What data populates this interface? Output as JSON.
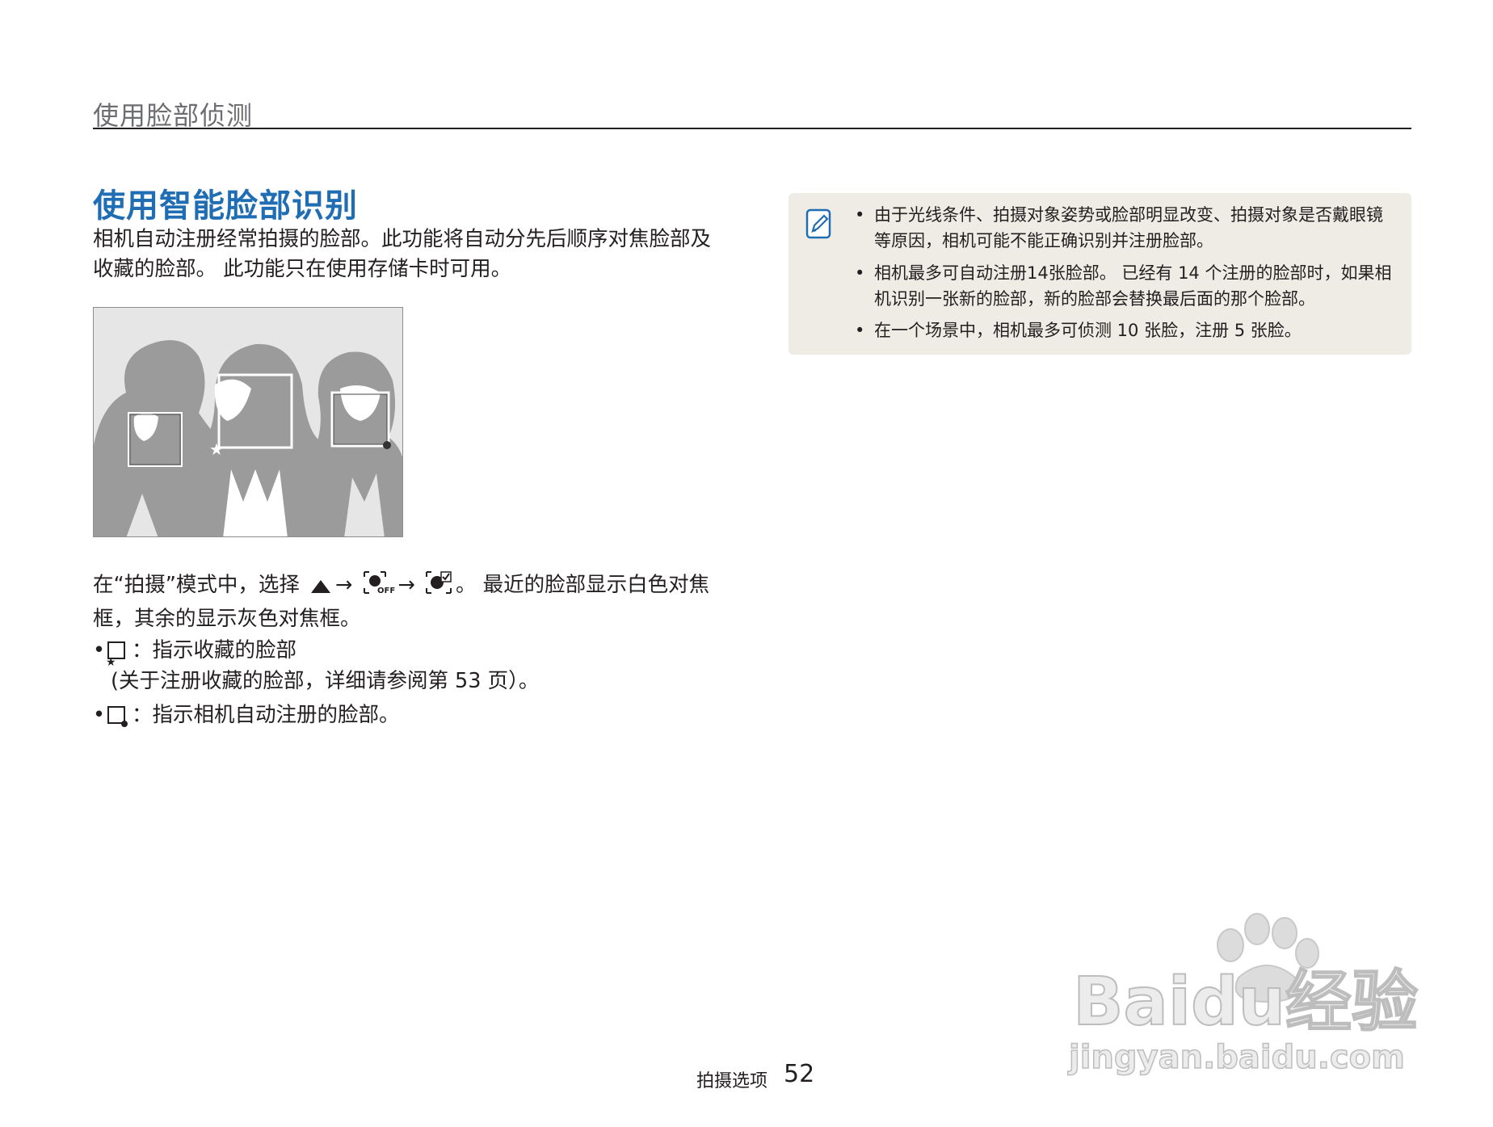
{
  "header": {
    "section": "使用脸部侦测"
  },
  "title": "使用智能脸部识别",
  "intro": "相机自动注册经常拍摄的脸部。此功能将自动分先后顺序对焦脸部及收藏的脸部。 此功能只在使用存储卡时可用。",
  "instruction": {
    "before": "在“拍摄”模式中，选择",
    "arrow": "→",
    "after": "。 最近的脸部显示白色对焦框，其余的显示灰色对焦框。",
    "icons": [
      "menu-up-icon",
      "face-detection-off-icon",
      "smart-face-recognition-icon"
    ]
  },
  "bullets": [
    {
      "text": "：指示收藏的脸部",
      "sub": "(关于注册收藏的脸部，详细请参阅第 53 页）。",
      "icon": "favorite-face-frame-icon"
    },
    {
      "text": "：指示相机自动注册的脸部。",
      "icon": "auto-registered-face-frame-icon"
    }
  ],
  "notes": [
    "由于光线条件、拍摄对象姿势或脸部明显改变、拍摄对象是否戴眼镜等原因，相机可能不能正确识别并注册脸部。",
    "相机最多可自动注册14张脸部。 已经有 14 个注册的脸部时，如果相机识别一张新的脸部，新的脸部会替换最后面的那个脸部。",
    "在一个场景中，相机最多可侦测 10 张脸，注册 5 张脸。"
  ],
  "footer": {
    "label": "拍摄选项",
    "page": "52"
  },
  "watermark": {
    "brand": "Baidu经验",
    "url": "jingyan.baidu.com"
  },
  "colors": {
    "title": "#1f6db3",
    "note_bg": "#efece6",
    "figure_gray": "#9b9b9b"
  }
}
